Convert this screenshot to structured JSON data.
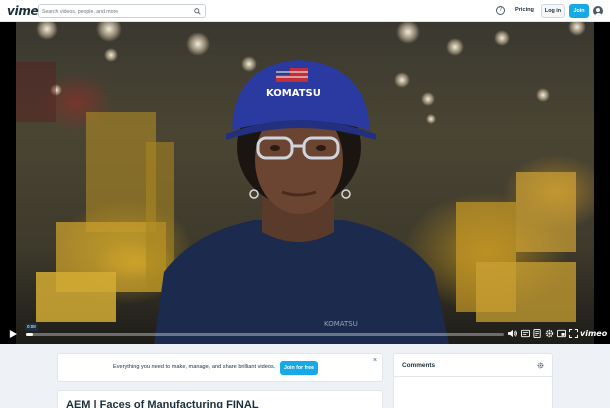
{
  "header": {
    "logo_text": "vimeo",
    "search_placeholder": "Search videos, people, and more",
    "help_icon": "help-circle-icon",
    "pricing_label": "Pricing",
    "login_label": "Log in",
    "join_label": "Join",
    "avatar_icon": "user-avatar-icon"
  },
  "player": {
    "timecode": "0:08",
    "progress": 0.015,
    "brand_mark": "vimeo",
    "helmet_text": "KOMATSU",
    "shirt_text": "KOMATSU",
    "icons": [
      "play-icon",
      "volume-icon",
      "captions-icon",
      "transcript-icon",
      "settings-icon",
      "picture-in-picture-icon",
      "fullscreen-icon"
    ]
  },
  "promo": {
    "message": "Everything you need to make, manage, and share brilliant videos.",
    "cta_label": "Join for free",
    "close_glyph": "×"
  },
  "comments": {
    "title": "Comments"
  },
  "video": {
    "title": "AEM | Faces of Manufacturing FINAL"
  },
  "colors": {
    "accent": "#17a8e8",
    "text": "#1a2e3b",
    "page_bg": "#eef1f5",
    "helmet": "#2b3aa0",
    "shirt": "#1c2a4d"
  }
}
